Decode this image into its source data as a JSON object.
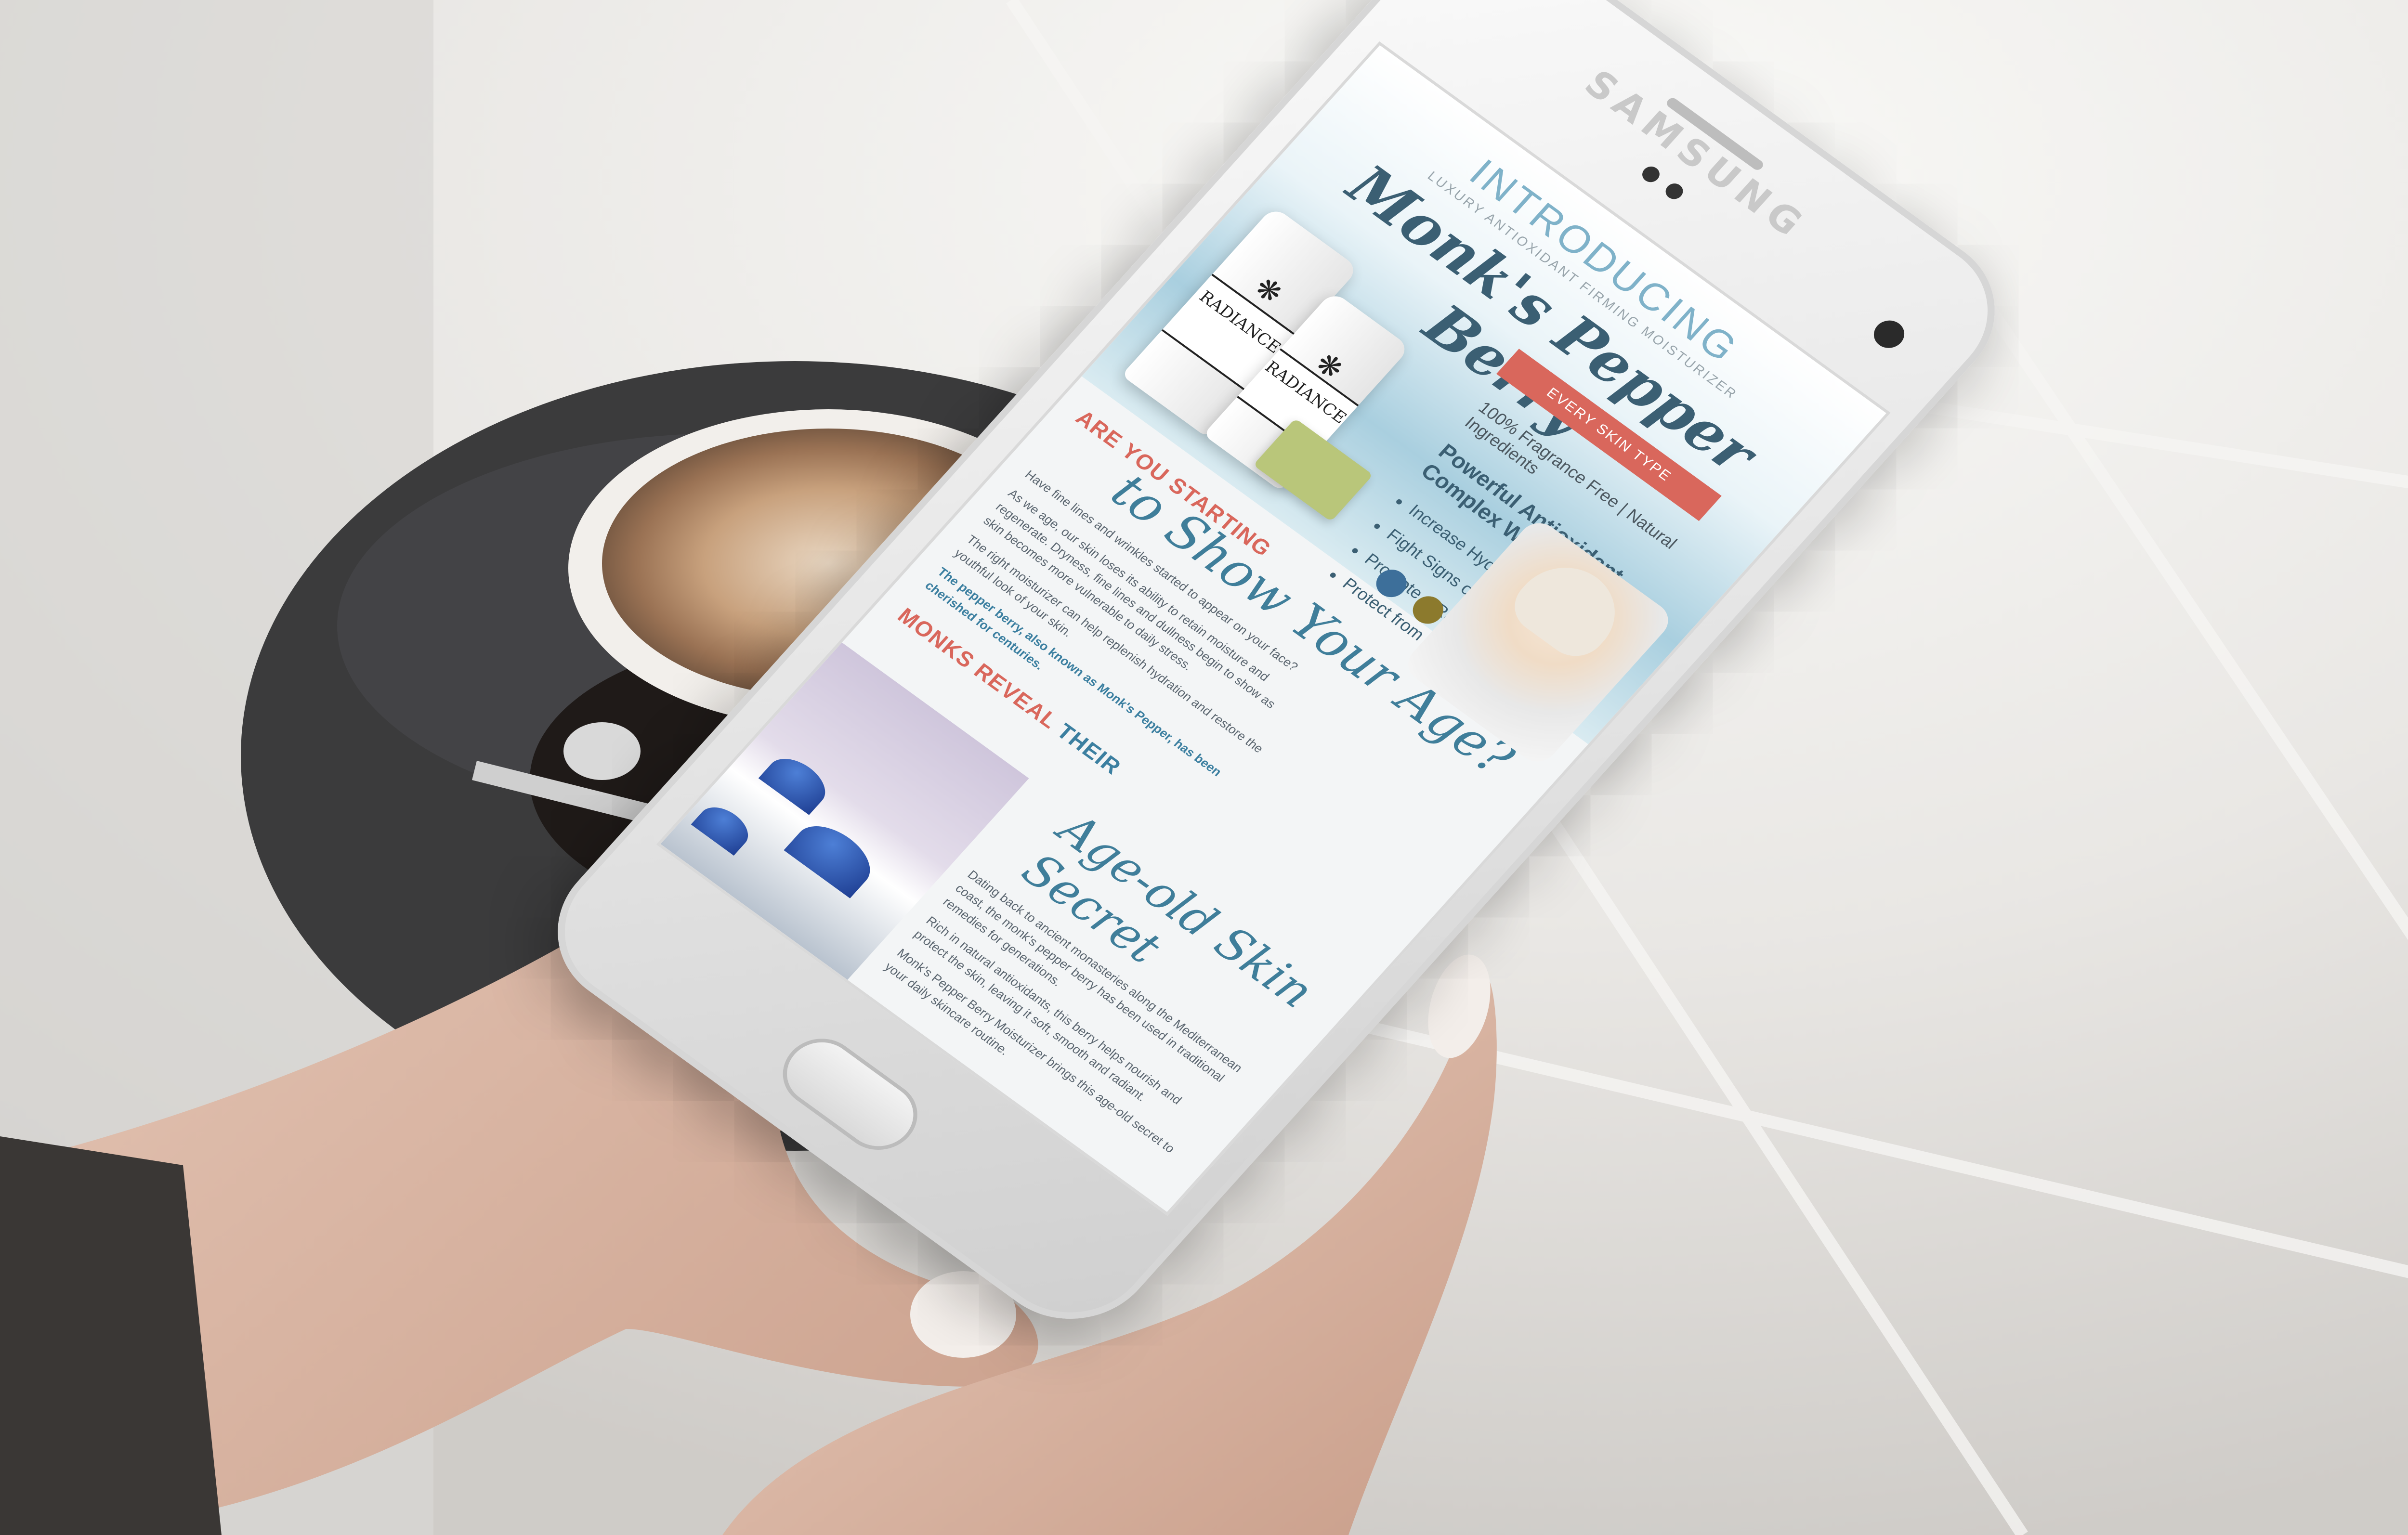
{
  "phone": {
    "brand": "SAMSUNG"
  },
  "screen": {
    "hero": {
      "intro": "INTRODUCING",
      "subline": "LUXURY ANTIOXIDANT FIRMING MOISTURIZER",
      "product_name": "Monk's Pepper Berry",
      "ribbon": "EVERY SKIN TYPE",
      "bottle_label": "RADIANCE",
      "features": {
        "line1": "100% Fragrance Free | Natural Ingredients",
        "line2": "Powerful Antioxidant Complex Works to:",
        "items": [
          "Increase Hydration",
          "Fight Signs of Aging",
          "Promote a Radiant Glow",
          "Protect from Free Radical Damage"
        ]
      }
    },
    "section1": {
      "kicker_red": "ARE YOU STARTING",
      "headline": "to Show Your Age?",
      "paragraphs": [
        "Have fine lines and wrinkles started to appear on your face?",
        "As we age, our skin loses its ability to retain moisture and regenerate. Dryness, fine lines and dullness begin to show as skin becomes more vulnerable to daily stress.",
        "The right moisturizer can help replenish hydration and restore the youthful look of your skin."
      ],
      "highlight": "The pepper berry, also known as Monk's Pepper, has been cherished for centuries."
    },
    "section2": {
      "kicker_red": "MONKS REVEAL",
      "kicker_blue": "THEIR",
      "headline": "Age-old Skin Secret",
      "paragraphs": [
        "Dating back to ancient monasteries along the Mediterranean coast, the monk's pepper berry has been used in traditional remedies for generations.",
        "Rich in natural antioxidants, this berry helps nourish and protect the skin, leaving it soft, smooth and radiant.",
        "Monk's Pepper Berry Moisturizer brings this age-old secret to your daily skincare routine."
      ]
    }
  }
}
